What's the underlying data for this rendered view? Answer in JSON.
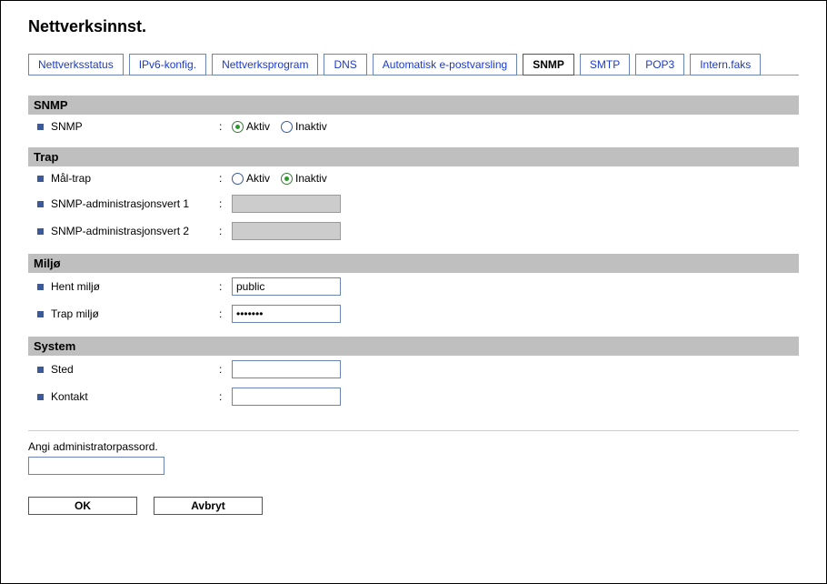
{
  "page_title": "Nettverksinnst.",
  "tabs": [
    {
      "label": "Nettverksstatus",
      "active": false
    },
    {
      "label": "IPv6-konfig.",
      "active": false
    },
    {
      "label": "Nettverksprogram",
      "active": false
    },
    {
      "label": "DNS",
      "active": false
    },
    {
      "label": "Automatisk e-postvarsling",
      "active": false
    },
    {
      "label": "SNMP",
      "active": true
    },
    {
      "label": "SMTP",
      "active": false
    },
    {
      "label": "POP3",
      "active": false
    },
    {
      "label": "Intern.faks",
      "active": false
    }
  ],
  "radio_labels": {
    "active": "Aktiv",
    "inactive": "Inaktiv"
  },
  "sections": {
    "snmp": {
      "title": "SNMP",
      "field_label": "SNMP",
      "value": "active"
    },
    "trap": {
      "title": "Trap",
      "target_label": "Mål-trap",
      "target_value": "inactive",
      "host1_label": "SNMP-administrasjonsvert 1",
      "host1_value": "",
      "host2_label": "SNMP-administrasjonsvert 2",
      "host2_value": ""
    },
    "env": {
      "title": "Miljø",
      "get_label": "Hent miljø",
      "get_value": "public",
      "trap_label": "Trap miljø",
      "trap_value": "•••••••"
    },
    "system": {
      "title": "System",
      "location_label": "Sted",
      "location_value": "",
      "contact_label": "Kontakt",
      "contact_value": ""
    }
  },
  "footer": {
    "pw_label": "Angi administratorpassord.",
    "pw_value": "",
    "ok": "OK",
    "cancel": "Avbryt"
  }
}
